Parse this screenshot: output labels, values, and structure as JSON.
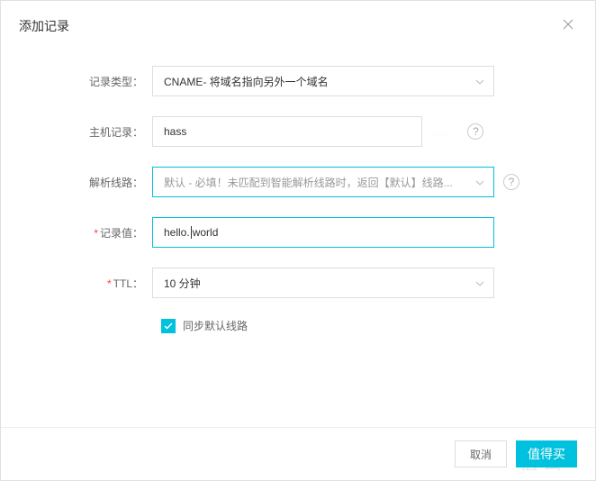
{
  "header": {
    "title": "添加记录"
  },
  "form": {
    "recordType": {
      "label": "记录类型：",
      "value": "CNAME- 将域名指向另外一个域名"
    },
    "hostRecord": {
      "label": "主机记录：",
      "value": "hass"
    },
    "line": {
      "label": "解析线路：",
      "value": "默认 - 必填！未匹配到智能解析线路时，返回【默认】线路..."
    },
    "recordValue": {
      "label": "记录值：",
      "value_a": "hello.",
      "value_b": "world"
    },
    "ttl": {
      "label": "TTL：",
      "value": "10 分钟"
    },
    "syncDefault": {
      "label": "同步默认线路",
      "checked": true
    }
  },
  "footer": {
    "cancel": "取消",
    "confirm": "值得买"
  },
  "watermark": "值   么"
}
